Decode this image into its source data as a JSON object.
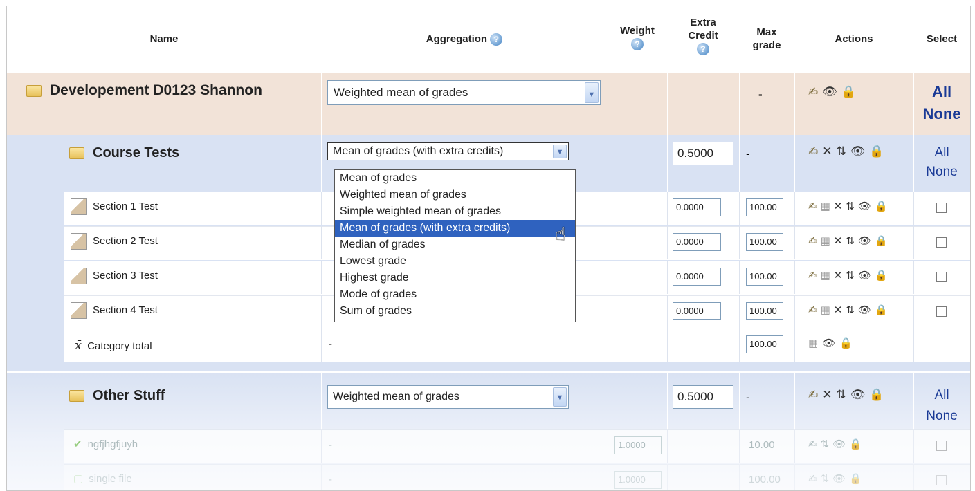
{
  "headers": {
    "name": "Name",
    "aggregation": "Aggregation",
    "weight": "Weight",
    "extra_credit": "Extra Credit",
    "max_grade": "Max grade",
    "actions": "Actions",
    "select": "Select"
  },
  "course": {
    "name": "Developement D0123 Shannon",
    "aggregation": "Weighted mean of grades",
    "max_grade": "-",
    "select_all": "All",
    "select_none": "None"
  },
  "course_tests": {
    "name": "Course Tests",
    "aggregation": "Mean of grades (with extra credits)",
    "extra_credit": "0.5000",
    "max_grade": "-",
    "select_all": "All",
    "select_none": "None",
    "items": [
      {
        "name": "Section 1 Test",
        "extra_credit": "0.0000",
        "max_grade": "100.00"
      },
      {
        "name": "Section 2 Test",
        "extra_credit": "0.0000",
        "max_grade": "100.00"
      },
      {
        "name": "Section 3 Test",
        "extra_credit": "0.0000",
        "max_grade": "100.00"
      },
      {
        "name": "Section 4 Test",
        "extra_credit": "0.0000",
        "max_grade": "100.00"
      }
    ],
    "total": {
      "name": "Category total",
      "aggregation": "-",
      "max_grade": "100.00"
    }
  },
  "dropdown_options": [
    "Mean of grades",
    "Weighted mean of grades",
    "Simple weighted mean of grades",
    "Mean of grades (with extra credits)",
    "Median of grades",
    "Lowest grade",
    "Highest grade",
    "Mode of grades",
    "Sum of grades"
  ],
  "dropdown_selected_index": 3,
  "other_stuff": {
    "name": "Other Stuff",
    "aggregation": "Weighted mean of grades",
    "extra_credit": "0.5000",
    "max_grade": "-",
    "select_all": "All",
    "select_none": "None",
    "items": [
      {
        "name": "ngfjhgfjuyh",
        "aggregation": "-",
        "weight": "1.0000",
        "max_grade": "10.00"
      },
      {
        "name": "single file",
        "aggregation": "-",
        "weight": "1.0000",
        "max_grade": "100.00"
      }
    ]
  },
  "colors": {
    "course_bg": "#f2e3d8",
    "category_bg": "#d9e2f3",
    "select_link": "#1a3a96",
    "dropdown_highlight": "#2f62bf"
  }
}
